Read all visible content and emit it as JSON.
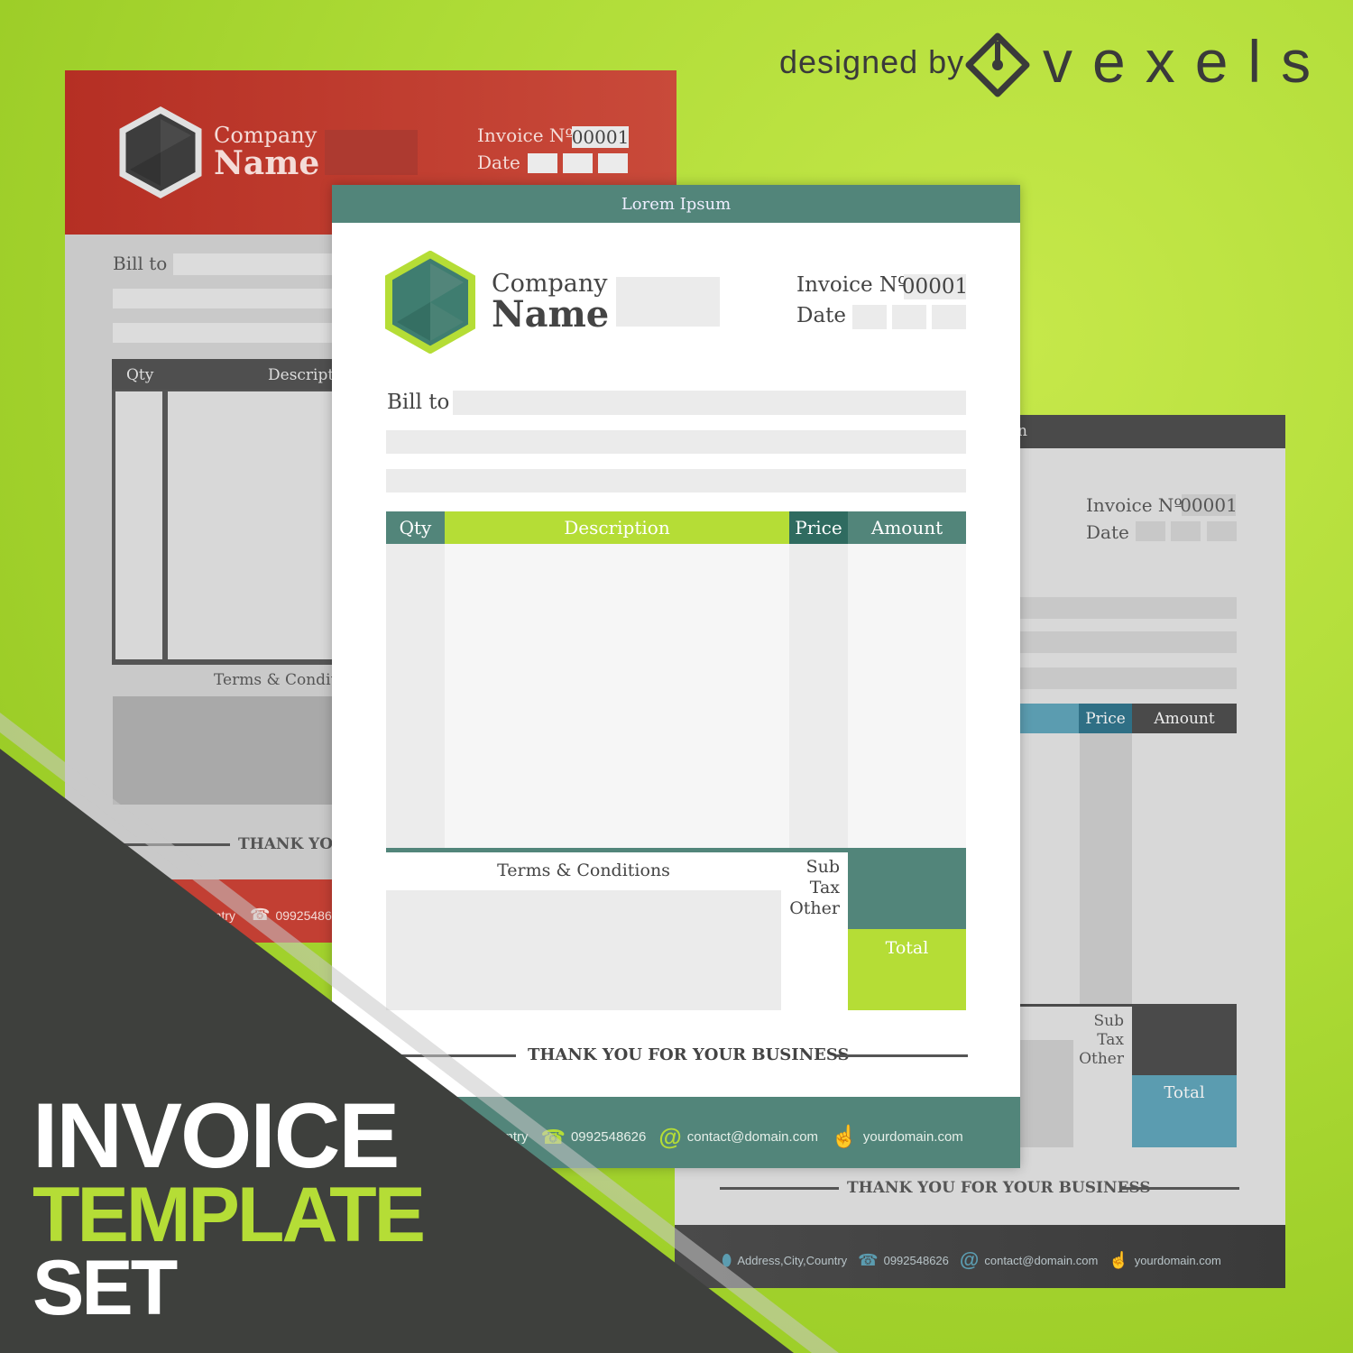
{
  "brand": {
    "designed_by": "designed by",
    "name": "vexels"
  },
  "title": {
    "line1": "INVOICE",
    "line2": "TEMPLATE",
    "line3": "SET"
  },
  "colors": {
    "teal": "#52857a",
    "dark_teal": "#2f6b60",
    "green": "#b5dd36",
    "red": "#c23f33",
    "gray_dark": "#4a4a4a",
    "blue": "#5b9cb0"
  },
  "front": {
    "header": "Lorem Ipsum",
    "company_line1": "Company",
    "company_line2": "Name",
    "invoice_label": "Invoice Nº",
    "invoice_number": "00001",
    "date_label": "Date",
    "bill_to": "Bill to",
    "columns": [
      "Qty",
      "Description",
      "Price",
      "Amount"
    ],
    "terms": "Terms & Conditions",
    "sub": "Sub",
    "tax": "Tax",
    "other": "Other",
    "total": "Total",
    "thanks": "THANK YOU FOR YOUR BUSINESS",
    "footer": {
      "address": "Country",
      "phone": "0992548626",
      "email": "contact@domain.com",
      "web": "yourdomain.com"
    }
  },
  "red": {
    "company_line1": "Company",
    "company_line2": "Name",
    "invoice_label": "Invoice Nº",
    "invoice_number": "00001",
    "date_label": "Date",
    "bill_to": "Bill to",
    "col_qty": "Qty",
    "col_desc": "Descripti",
    "terms": "Terms & Conditi",
    "thanks": "THANK YOU",
    "footer": {
      "address": "Country",
      "phone": "0992548626"
    }
  },
  "gray": {
    "header": "n",
    "invoice_label": "Invoice Nº",
    "invoice_number": "00001",
    "date_label": "Date",
    "col_price": "Price",
    "col_amount": "Amount",
    "sub": "Sub",
    "tax": "Tax",
    "other": "Other",
    "total": "Total",
    "thanks": "THANK YOU FOR YOUR BUSINESS",
    "footer": {
      "address": "Address,City,Country",
      "phone": "0992548626",
      "email": "contact@domain.com",
      "web": "yourdomain.com"
    }
  }
}
